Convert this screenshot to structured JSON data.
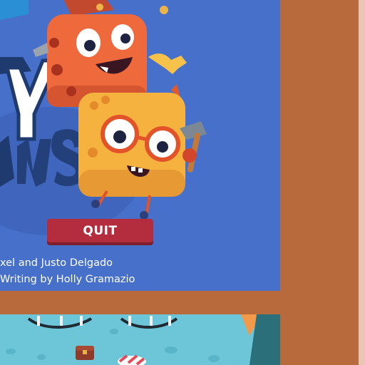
{
  "menu": {
    "quit_label": "QUIT"
  },
  "credits": {
    "line1": "xel and Justo Delgado",
    "line2": "Writing by Holly Gramazio"
  },
  "icons": {
    "characters": [
      "orange-dice-character",
      "yellow-dice-character-with-glasses"
    ],
    "held_item": "hammer-icon",
    "level_props": [
      "chandelier-icon",
      "treasure-chest-icon",
      "striped-candy-icon"
    ]
  },
  "colors": {
    "frame": "#b96a3d",
    "title_background": "#4670c9",
    "quit_button": "#b42d3e",
    "level_water": "#6cc6d8"
  }
}
